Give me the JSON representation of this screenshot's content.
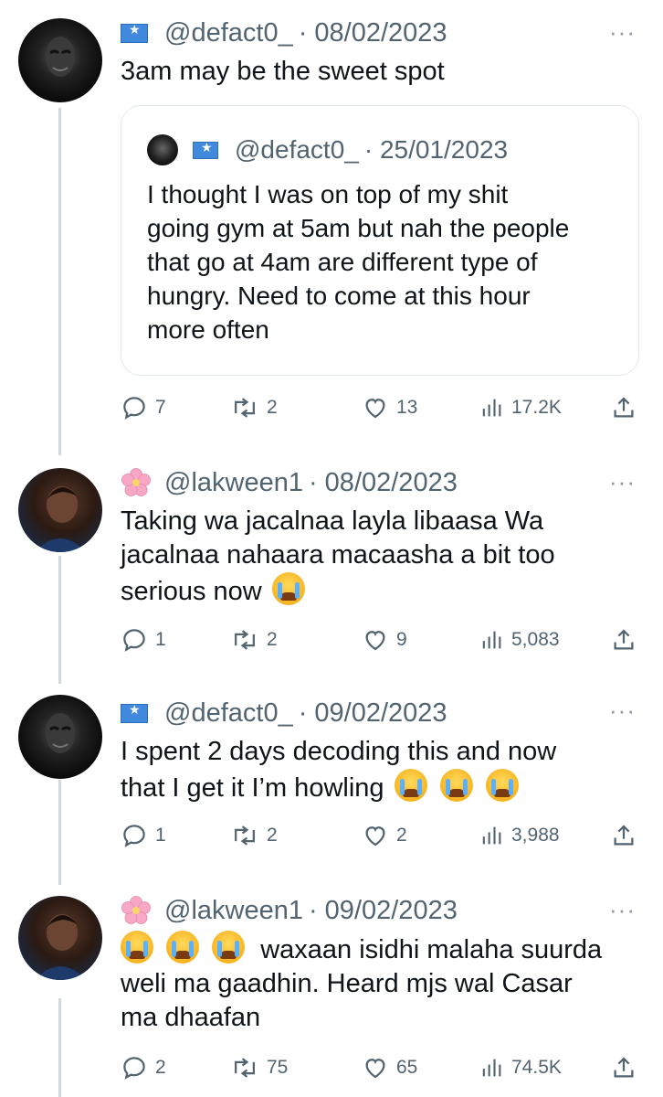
{
  "tweets": [
    {
      "handle": "@defact0_",
      "date": "· 08/02/2023",
      "text": "3am may be the sweet spot",
      "more": "···",
      "quote": {
        "handle": "@defact0_",
        "date": "· 25/01/2023",
        "lines": [
          "I thought I was on top of my shit",
          "going gym at 5am but nah the people",
          "that go at 4am are different type of",
          "hungry. Need to come at this hour",
          "more often"
        ]
      },
      "stats": {
        "replies": "7",
        "retweets": "2",
        "likes": "13",
        "views": "17.2K"
      }
    },
    {
      "handle": "@lakween1",
      "date": "· 08/02/2023",
      "lines": [
        "Taking wa jacalnaa layla libaasa Wa",
        "jacalnaa nahaara macaasha a bit too",
        "serious now"
      ],
      "more": "···",
      "stats": {
        "replies": "1",
        "retweets": "2",
        "likes": "9",
        "views": "5,083"
      }
    },
    {
      "handle": "@defact0_",
      "date": "· 09/02/2023",
      "lines": [
        "I spent 2 days decoding this and now",
        "that I get it I’m howling"
      ],
      "more": "···",
      "stats": {
        "replies": "1",
        "retweets": "2",
        "likes": "2",
        "views": "3,988"
      }
    },
    {
      "handle": "@lakween1",
      "date": "· 09/02/2023",
      "lines": [
        "waxaan isidhi malaha suurda",
        "weli ma gaadhin. Heard mjs wal Casar",
        "ma dhaafan"
      ],
      "more": "···",
      "stats": {
        "replies": "2",
        "retweets": "75",
        "likes": "65",
        "views": "74.5K"
      }
    }
  ],
  "icons": {
    "reply": "reply-icon",
    "retweet": "retweet-icon",
    "like": "heart-icon",
    "views": "views-icon",
    "share": "share-icon",
    "flag": "somalia-flag-icon",
    "blossom": "cherry-blossom-icon",
    "emoji": "loudly-crying-face-icon"
  },
  "colors": {
    "text": "#0f1419",
    "muted": "#536471",
    "border": "#e1e8ed",
    "flag": "#4189dd"
  }
}
